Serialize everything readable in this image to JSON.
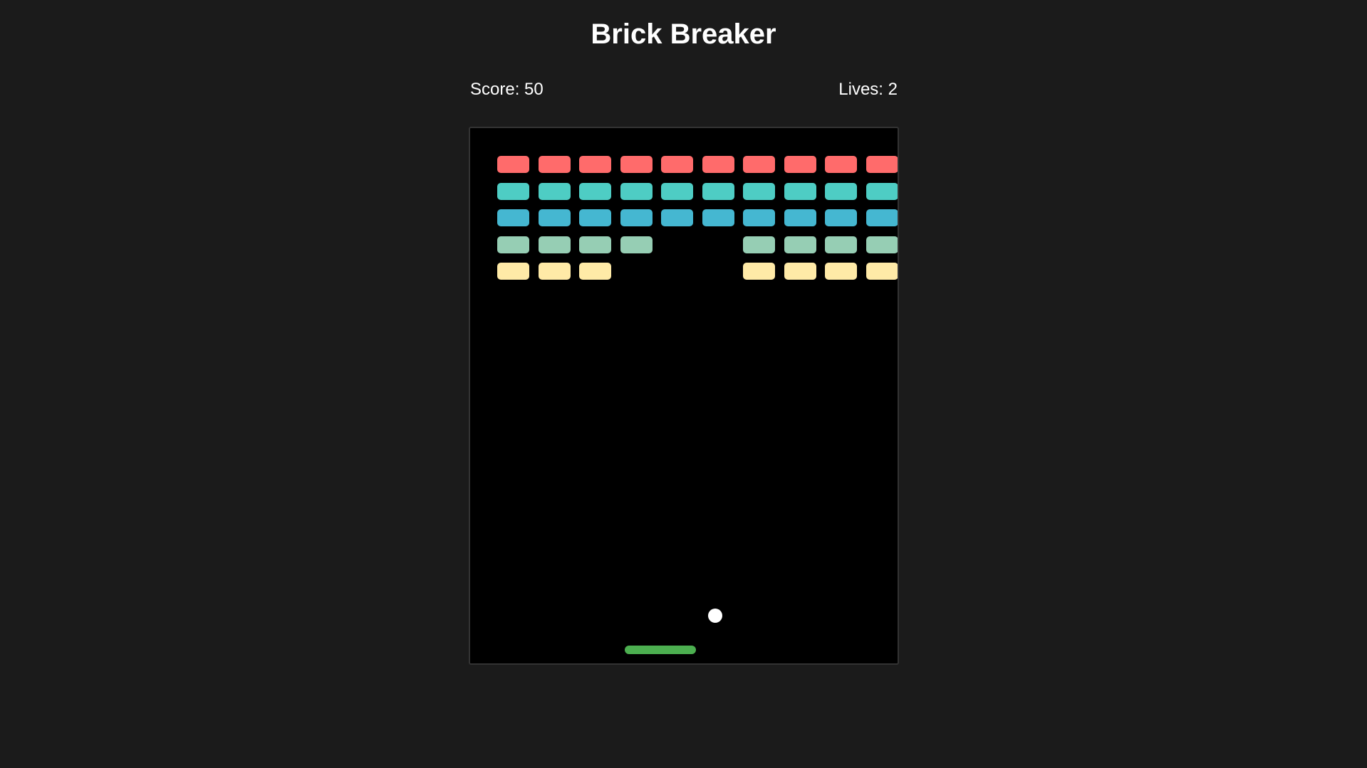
{
  "title": "Brick Breaker",
  "hud": {
    "score_text": "Score: 50",
    "lives_text": "Lives: 2",
    "score": 50,
    "lives": 2
  },
  "colors": {
    "background": "#1b1b1b",
    "board": "#000000",
    "paddle": "#4caf50",
    "ball": "#ffffff",
    "rows": [
      "#ff6b6b",
      "#4ecdc4",
      "#45b7d1",
      "#96ceb4",
      "#ffeaa7"
    ]
  },
  "bricks": {
    "rows": 5,
    "cols": 10,
    "present": [
      [
        1,
        1,
        1,
        1,
        1,
        1,
        1,
        1,
        1,
        1
      ],
      [
        1,
        1,
        1,
        1,
        1,
        1,
        1,
        1,
        1,
        1
      ],
      [
        1,
        1,
        1,
        1,
        1,
        1,
        1,
        1,
        1,
        1
      ],
      [
        1,
        1,
        1,
        1,
        0,
        0,
        1,
        1,
        1,
        1
      ],
      [
        1,
        1,
        1,
        0,
        0,
        0,
        1,
        1,
        1,
        1
      ]
    ]
  }
}
